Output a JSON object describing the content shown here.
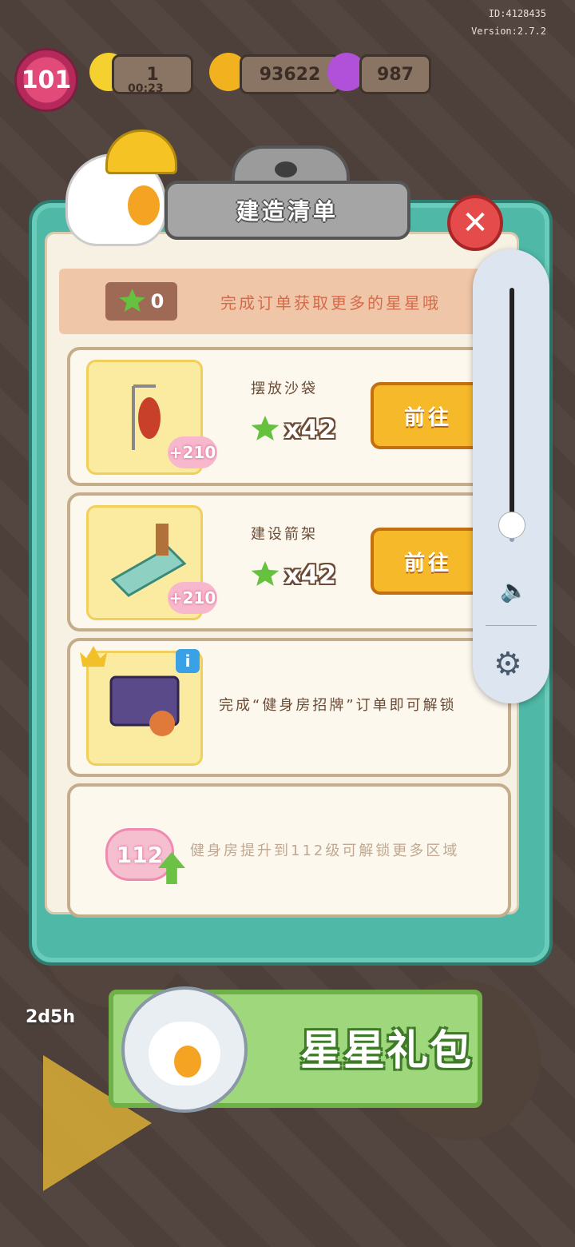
{
  "hud": {
    "id_label": "ID:4128435",
    "version_label": "Version:2.7.2",
    "level": "101",
    "energy": "1",
    "energy_timer": "00:23",
    "coins": "93622",
    "gems": "987",
    "side_timer": "2d5h"
  },
  "panel": {
    "title": "建造清单",
    "star_count": "0",
    "banner_text": "完成订单获取更多的星星哦",
    "tasks": [
      {
        "name": "摆放沙袋",
        "requirement": "x42",
        "reward": "+210",
        "button": "前往"
      },
      {
        "name": "建设箭架",
        "requirement": "x42",
        "reward": "+210",
        "button": "前往"
      }
    ],
    "locked_task": {
      "text": "完成“健身房招牌”订单即可解锁"
    },
    "level_unlock": {
      "level": "112",
      "text": "健身房提升到112级可解锁更多区域"
    }
  },
  "gift": {
    "label": "星星礼包"
  },
  "colors": {
    "panel": "#4fb8a6",
    "button": "#f6b92a",
    "close": "#e64b4b",
    "star": "#66c23e"
  }
}
